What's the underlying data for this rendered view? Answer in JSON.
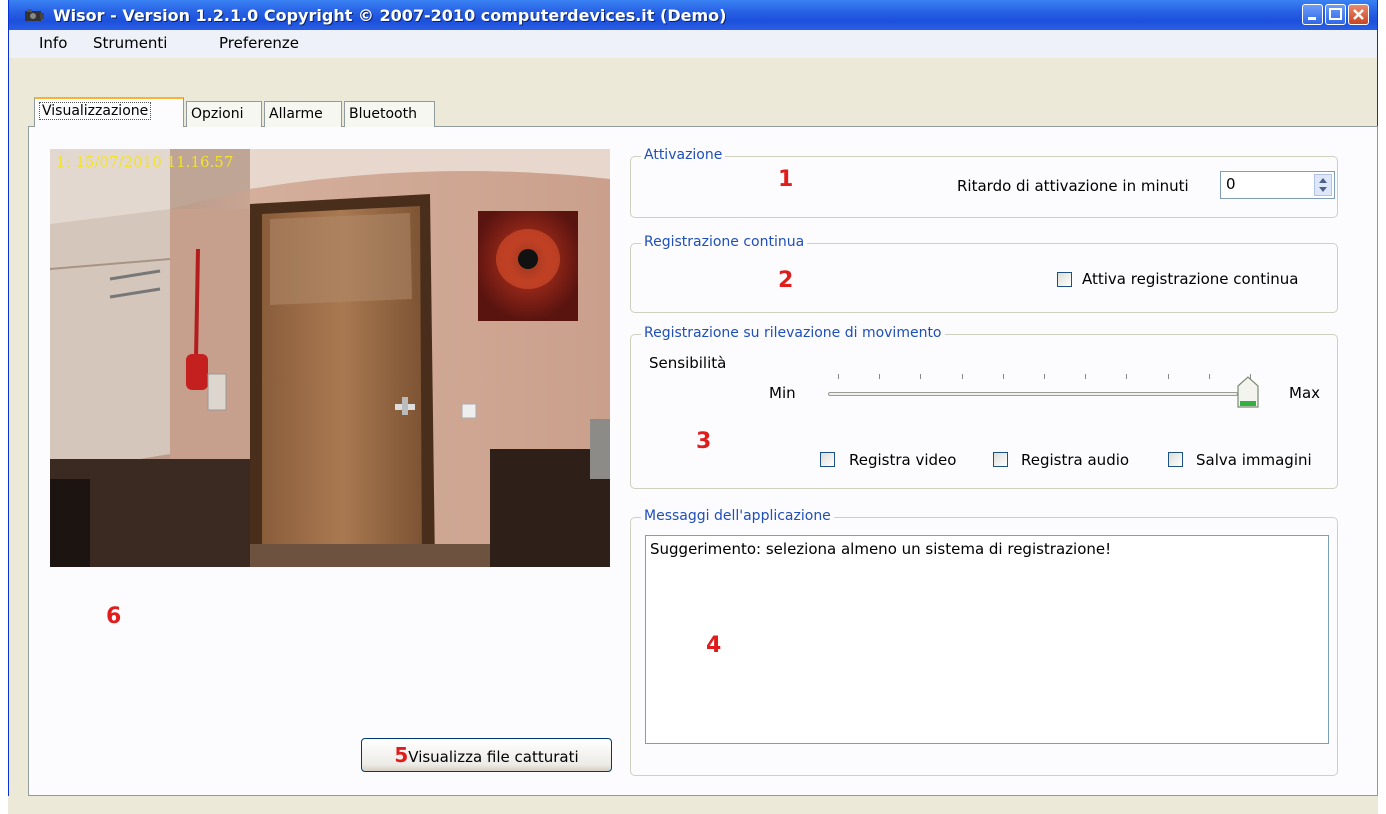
{
  "window": {
    "title": "Wisor - Version 1.2.1.0 Copyright © 2007-2010 computerdevices.it (Demo)"
  },
  "menu": [
    "Info",
    "Strumenti",
    "Preferenze"
  ],
  "tabs": [
    "Visualizzazione",
    "Opzioni",
    "Allarme",
    "Bluetooth"
  ],
  "camera": {
    "timestamp": "1: 15/07/2010 11.16.57"
  },
  "attivazione": {
    "title": "Attivazione",
    "label": "Ritardo  di attivazione in minuti",
    "value": "0",
    "marker": "1"
  },
  "continua": {
    "title": "Registrazione continua",
    "checkbox_label": "Attiva registrazione continua",
    "marker": "2"
  },
  "movimento": {
    "title": "Registrazione su rilevazione di movimento",
    "sensibilita_label": "Sensibilità",
    "min_label": "Min",
    "max_label": "Max",
    "slider_value": 1.0,
    "check_video": "Registra video",
    "check_audio": "Registra audio",
    "check_immagini": "Salva immagini",
    "marker": "3"
  },
  "messaggi": {
    "title": "Messaggi dell'applicazione",
    "text": "Suggerimento: seleziona almeno un sistema di registrazione!",
    "marker": "4"
  },
  "capture_button": {
    "marker": "5",
    "label": "Visualizza file catturati"
  },
  "camera_marker": "6",
  "colors": {
    "titlebar": "#2a64e6",
    "group_title": "#1f4fb8",
    "marker_red": "#e01d1d",
    "timestamp_yellow": "#f2e32a"
  }
}
